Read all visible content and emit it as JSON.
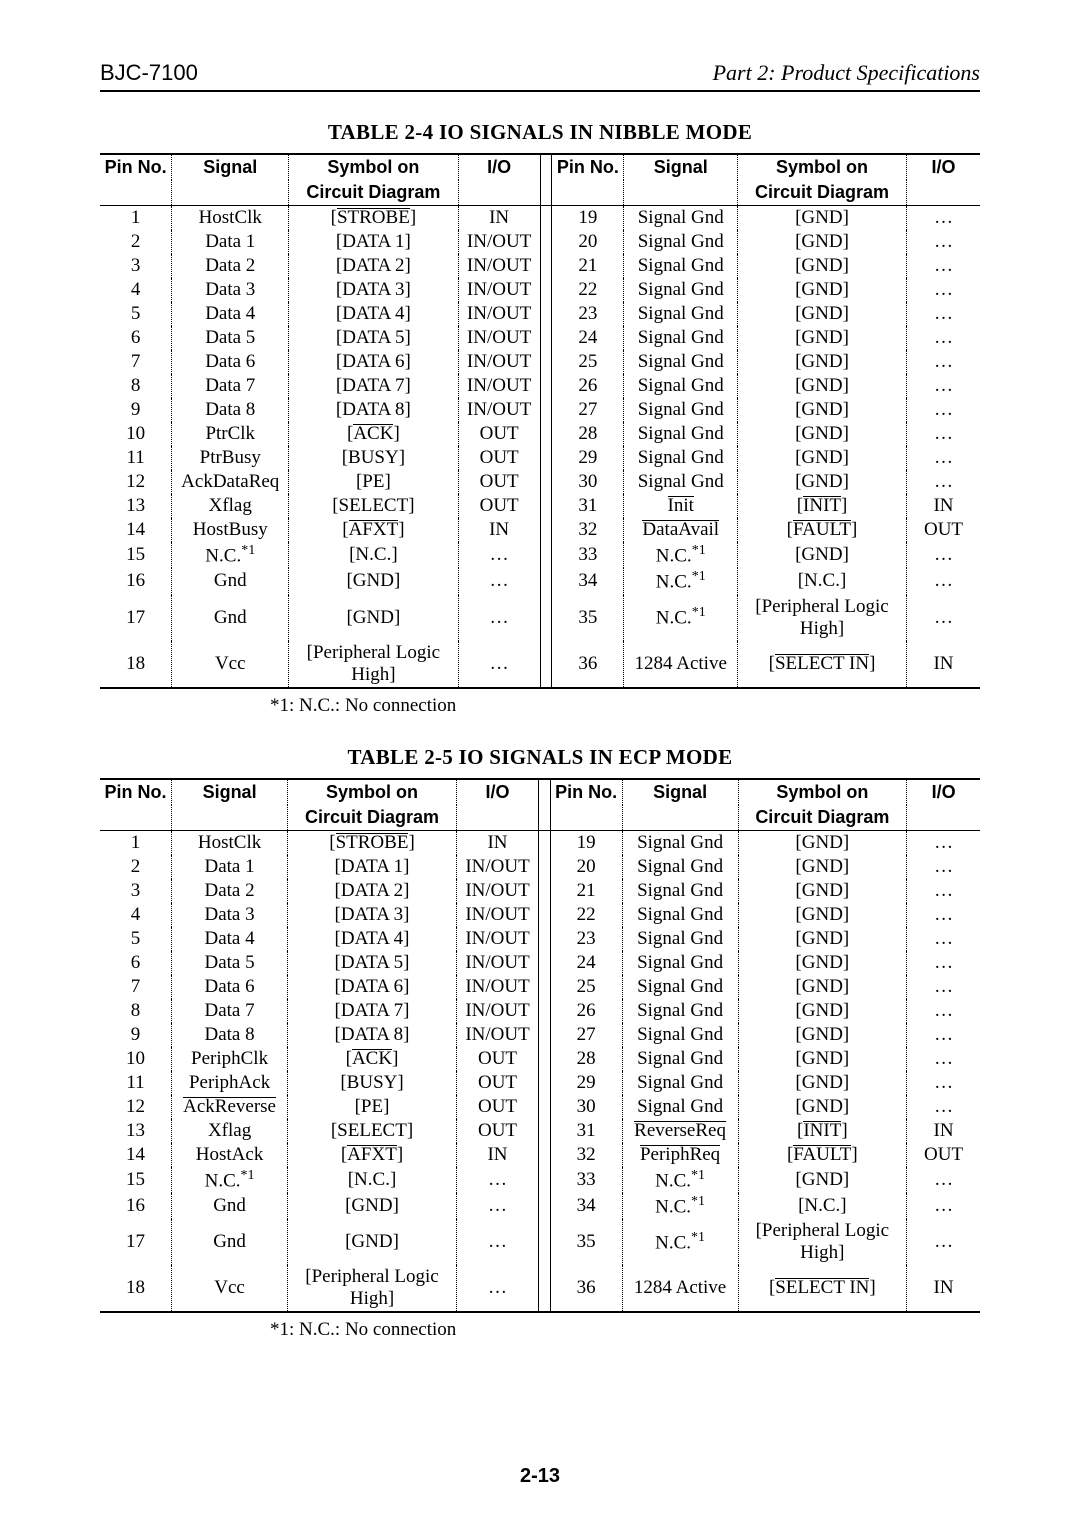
{
  "header": {
    "model": "BJC-7100",
    "part": "Part 2: Product Specifications"
  },
  "pagenum": "2-13",
  "note1": "*1:  N.C.: No connection",
  "note2": "*1: N.C.: No connection",
  "table1": {
    "title": "TABLE 2-4 IO SIGNALS IN NIBBLE MODE",
    "head": {
      "pin": "Pin No.",
      "signal": "Signal",
      "sym1": "Symbol on",
      "sym2": "Circuit Diagram",
      "io": "I/O"
    },
    "left": [
      {
        "p": "1",
        "s": "HostClk",
        "y": "[STROBE]",
        "o1": true,
        "i": "IN"
      },
      {
        "p": "2",
        "s": "Data 1",
        "y": "[DATA 1]",
        "i": "IN/OUT"
      },
      {
        "p": "3",
        "s": "Data 2",
        "y": "[DATA 2]",
        "i": "IN/OUT"
      },
      {
        "p": "4",
        "s": "Data 3",
        "y": "[DATA 3]",
        "i": "IN/OUT"
      },
      {
        "p": "5",
        "s": "Data 4",
        "y": "[DATA 4]",
        "i": "IN/OUT"
      },
      {
        "p": "6",
        "s": "Data 5",
        "y": "[DATA 5]",
        "i": "IN/OUT"
      },
      {
        "p": "7",
        "s": "Data 6",
        "y": "[DATA 6]",
        "i": "IN/OUT"
      },
      {
        "p": "8",
        "s": "Data 7",
        "y": "[DATA 7]",
        "i": "IN/OUT"
      },
      {
        "p": "9",
        "s": "Data 8",
        "y": "[DATA 8]",
        "i": "IN/OUT"
      },
      {
        "p": "10",
        "s": "PtrClk",
        "y": "[ACK]",
        "o2": true,
        "i": "OUT"
      },
      {
        "p": "11",
        "s": "PtrBusy",
        "y": "[BUSY]",
        "i": "OUT"
      },
      {
        "p": "12",
        "s": "AckDataReq",
        "y": "[PE]",
        "i": "OUT"
      },
      {
        "p": "13",
        "s": "Xflag",
        "y": "[SELECT]",
        "i": "OUT"
      },
      {
        "p": "14",
        "s": "HostBusy",
        "y": "[AFXT]",
        "o1": true,
        "i": "IN"
      },
      {
        "p": "15",
        "s": "N.C.",
        "sup": "*1",
        "y": "[N.C.]",
        "i": "…"
      },
      {
        "p": "16",
        "s": "Gnd",
        "y": "[GND]",
        "i": "…"
      },
      {
        "p": "17",
        "s": "Gnd",
        "y": "[GND]",
        "i": "…"
      },
      {
        "p": "18",
        "s": "Vcc",
        "y": "[Peripheral Logic High]",
        "i": "…"
      }
    ],
    "right": [
      {
        "p": "19",
        "s": "Signal Gnd",
        "y": "[GND]",
        "i": "…"
      },
      {
        "p": "20",
        "s": "Signal Gnd",
        "y": "[GND]",
        "i": "…"
      },
      {
        "p": "21",
        "s": "Signal Gnd",
        "y": "[GND]",
        "i": "…"
      },
      {
        "p": "22",
        "s": "Signal Gnd",
        "y": "[GND]",
        "i": "…"
      },
      {
        "p": "23",
        "s": "Signal Gnd",
        "y": "[GND]",
        "i": "…"
      },
      {
        "p": "24",
        "s": "Signal Gnd",
        "y": "[GND]",
        "i": "…"
      },
      {
        "p": "25",
        "s": "Signal Gnd",
        "y": "[GND]",
        "i": "…"
      },
      {
        "p": "26",
        "s": "Signal Gnd",
        "y": "[GND]",
        "i": "…"
      },
      {
        "p": "27",
        "s": "Signal Gnd",
        "y": "[GND]",
        "i": "…"
      },
      {
        "p": "28",
        "s": "Signal Gnd",
        "y": "[GND]",
        "i": "…"
      },
      {
        "p": "29",
        "s": "Signal Gnd",
        "y": "[GND]",
        "i": "…"
      },
      {
        "p": "30",
        "s": "Signal Gnd",
        "y": "[GND]",
        "i": "…"
      },
      {
        "p": "31",
        "s": "Init",
        "ovs": true,
        "y": "[INIT]",
        "o1": true,
        "i": "IN"
      },
      {
        "p": "32",
        "s": "DataAvail",
        "ovs": true,
        "y": "[FAULT]",
        "o1": true,
        "i": "OUT"
      },
      {
        "p": "33",
        "s": "N.C.",
        "sup": "*1",
        "y": "[GND]",
        "i": "…"
      },
      {
        "p": "34",
        "s": "N.C.",
        "sup": "*1",
        "y": "[N.C.]",
        "i": "…"
      },
      {
        "p": "35",
        "s": "N.C.",
        "sup": "*1",
        "y": "[Peripheral Logic High]",
        "i": "…"
      },
      {
        "p": "36",
        "s": "1284 Active",
        "y": "[SELECT IN]",
        "o1": true,
        "i": "IN"
      }
    ]
  },
  "table2": {
    "title": "TABLE 2-5 IO SIGNALS IN ECP MODE",
    "head": {
      "pin": "Pin No.",
      "signal": "Signal",
      "sym1": "Symbol on",
      "sym2": "Circuit Diagram",
      "io": "I/O"
    },
    "left": [
      {
        "p": "1",
        "s": "HostClk",
        "y": "[STROBE]",
        "o1": true,
        "i": "IN"
      },
      {
        "p": "2",
        "s": "Data 1",
        "y": "[DATA 1]",
        "i": "IN/OUT"
      },
      {
        "p": "3",
        "s": "Data 2",
        "y": "[DATA 2]",
        "i": "IN/OUT"
      },
      {
        "p": "4",
        "s": "Data 3",
        "y": "[DATA 3]",
        "i": "IN/OUT"
      },
      {
        "p": "5",
        "s": "Data 4",
        "y": "[DATA 4]",
        "i": "IN/OUT"
      },
      {
        "p": "6",
        "s": "Data 5",
        "y": "[DATA 5]",
        "i": "IN/OUT"
      },
      {
        "p": "7",
        "s": "Data 6",
        "y": "[DATA 6]",
        "i": "IN/OUT"
      },
      {
        "p": "8",
        "s": "Data 7",
        "y": "[DATA 7]",
        "i": "IN/OUT"
      },
      {
        "p": "9",
        "s": "Data 8",
        "y": "[DATA 8]",
        "i": "IN/OUT"
      },
      {
        "p": "10",
        "s": "PeriphClk",
        "y": "[ACK]",
        "o2": true,
        "i": "OUT"
      },
      {
        "p": "11",
        "s": "PeriphAck",
        "y": "[BUSY]",
        "i": "OUT"
      },
      {
        "p": "12",
        "s": "AckReverse",
        "ovs": true,
        "y": "[PE]",
        "i": "OUT"
      },
      {
        "p": "13",
        "s": "Xflag",
        "y": "[SELECT]",
        "i": "OUT"
      },
      {
        "p": "14",
        "s": "HostAck",
        "y": "[AFXT]",
        "o1": true,
        "i": "IN"
      },
      {
        "p": "15",
        "s": "N.C.",
        "sup": "*1",
        "y": "[N.C.]",
        "i": "…"
      },
      {
        "p": "16",
        "s": "Gnd",
        "y": "[GND]",
        "i": "…"
      },
      {
        "p": "17",
        "s": "Gnd",
        "y": "[GND]",
        "i": "…"
      },
      {
        "p": "18",
        "s": "Vcc",
        "y": "[Peripheral Logic High]",
        "i": "…"
      }
    ],
    "right": [
      {
        "p": "19",
        "s": "Signal Gnd",
        "y": "[GND]",
        "i": "…"
      },
      {
        "p": "20",
        "s": "Signal Gnd",
        "y": "[GND]",
        "i": "…"
      },
      {
        "p": "21",
        "s": "Signal Gnd",
        "y": "[GND]",
        "i": "…"
      },
      {
        "p": "22",
        "s": "Signal Gnd",
        "y": "[GND]",
        "i": "…"
      },
      {
        "p": "23",
        "s": "Signal Gnd",
        "y": "[GND]",
        "i": "…"
      },
      {
        "p": "24",
        "s": "Signal Gnd",
        "y": "[GND]",
        "i": "…"
      },
      {
        "p": "25",
        "s": "Signal Gnd",
        "y": "[GND]",
        "i": "…"
      },
      {
        "p": "26",
        "s": "Signal Gnd",
        "y": "[GND]",
        "i": "…"
      },
      {
        "p": "27",
        "s": "Signal Gnd",
        "y": "[GND]",
        "i": "…"
      },
      {
        "p": "28",
        "s": "Signal Gnd",
        "y": "[GND]",
        "i": "…"
      },
      {
        "p": "29",
        "s": "Signal Gnd",
        "y": "[GND]",
        "i": "…"
      },
      {
        "p": "30",
        "s": "Signal Gnd",
        "y": "[GND]",
        "i": "…"
      },
      {
        "p": "31",
        "s": "ReverseReq",
        "ovs": true,
        "y": "[INIT]",
        "o1": true,
        "i": "IN"
      },
      {
        "p": "32",
        "s": "PeriphReq",
        "ovs": true,
        "y": "[FAULT]",
        "o1": true,
        "i": "OUT"
      },
      {
        "p": "33",
        "s": "N.C.",
        "sup": "*1",
        "y": "[GND]",
        "i": "…"
      },
      {
        "p": "34",
        "s": "N.C.",
        "sup": "*1",
        "y": "[N.C.]",
        "i": "…"
      },
      {
        "p": "35",
        "s": "N.C.",
        "sup": "*1",
        "y": "[Peripheral Logic High]",
        "i": "…"
      },
      {
        "p": "36",
        "s": "1284 Active",
        "y": "[SELECT IN]",
        "o1": true,
        "i": "IN"
      }
    ]
  }
}
